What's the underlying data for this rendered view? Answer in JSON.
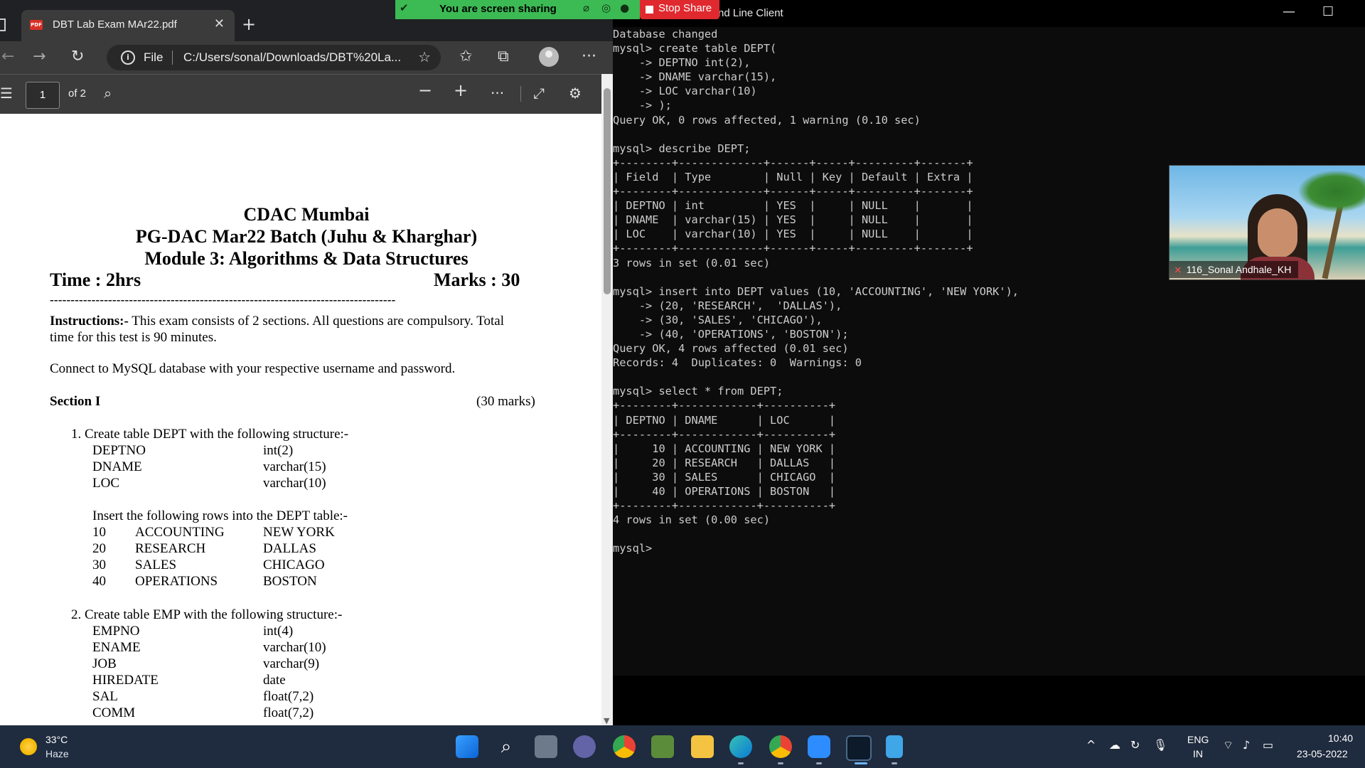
{
  "browser": {
    "tab_title": "DBT Lab Exam MAr22.pdf",
    "file_label": "File",
    "url": "C:/Users/sonal/Downloads/DBT%20La...",
    "page_number": "1",
    "page_total": "of 2"
  },
  "pdf": {
    "title1": "CDAC Mumbai",
    "title2": "PG-DAC Mar22 Batch (Juhu & Kharghar)",
    "title3": "Module 3: Algorithms & Data Structures",
    "time": "Time : 2hrs",
    "marks": "Marks : 30",
    "dashes": "-----------------------------------------------------------------------------------",
    "instructions_label": "Instructions:-",
    "instructions_text": " This exam consists of 2 sections.  All questions are compulsory. Total",
    "instructions_text2": "time for this test is 90 minutes.",
    "connect": "Connect to MySQL database with your respective username and password.",
    "section": "Section I",
    "section_marks": "(30 marks)",
    "q1": "1.   Create table DEPT with the following structure:-",
    "q1_fields": [
      {
        "name": "DEPTNO",
        "type": "int(2)"
      },
      {
        "name": "DNAME",
        "type": "varchar(15)"
      },
      {
        "name": "LOC",
        "type": "varchar(10)"
      }
    ],
    "q1_insert": "Insert the following rows into the DEPT table:-",
    "q1_rows": [
      {
        "no": "10",
        "name": "ACCOUNTING",
        "loc": "NEW YORK"
      },
      {
        "no": "20",
        "name": "RESEARCH",
        "loc": "DALLAS"
      },
      {
        "no": "30",
        "name": "SALES",
        "loc": "CHICAGO"
      },
      {
        "no": "40",
        "name": "OPERATIONS",
        "loc": "BOSTON"
      }
    ],
    "q2": "2.   Create table EMP with the following structure:-",
    "q2_fields": [
      {
        "name": "EMPNO",
        "type": "int(4)"
      },
      {
        "name": "ENAME",
        "type": "varchar(10)"
      },
      {
        "name": "JOB",
        "type": "varchar(9)"
      },
      {
        "name": "HIREDATE",
        "type": "date"
      },
      {
        "name": "SAL",
        "type": "float(7,2)"
      },
      {
        "name": "COMM",
        "type": "float(7,2)"
      }
    ]
  },
  "share": {
    "message": "You are screen sharing",
    "stop_label": "Stop Share"
  },
  "terminal": {
    "title": "nd Line Client",
    "output": "Database changed\nmysql> create table DEPT(\n    -> DEPTNO int(2),\n    -> DNAME varchar(15),\n    -> LOC varchar(10)\n    -> );\nQuery OK, 0 rows affected, 1 warning (0.10 sec)\n\nmysql> describe DEPT;\n+--------+-------------+------+-----+---------+-------+\n| Field  | Type        | Null | Key | Default | Extra |\n+--------+-------------+------+-----+---------+-------+\n| DEPTNO | int         | YES  |     | NULL    |       |\n| DNAME  | varchar(15) | YES  |     | NULL    |       |\n| LOC    | varchar(10) | YES  |     | NULL    |       |\n+--------+-------------+------+-----+---------+-------+\n3 rows in set (0.01 sec)\n\nmysql> insert into DEPT values (10, 'ACCOUNTING', 'NEW YORK'),\n    -> (20, 'RESEARCH',  'DALLAS'),\n    -> (30, 'SALES', 'CHICAGO'),\n    -> (40, 'OPERATIONS', 'BOSTON');\nQuery OK, 4 rows affected (0.01 sec)\nRecords: 4  Duplicates: 0  Warnings: 0\n\nmysql> select * from DEPT;\n+--------+------------+----------+\n| DEPTNO | DNAME      | LOC      |\n+--------+------------+----------+\n|     10 | ACCOUNTING | NEW YORK |\n|     20 | RESEARCH   | DALLAS   |\n|     30 | SALES      | CHICAGO  |\n|     40 | OPERATIONS | BOSTON   |\n+--------+------------+----------+\n4 rows in set (0.00 sec)\n\nmysql>"
  },
  "video": {
    "participant": "116_Sonal Andhale_KH"
  },
  "taskbar": {
    "temperature": "33°C",
    "weather": "Haze",
    "lang_line1": "ENG",
    "lang_line2": "IN",
    "time": "10:40",
    "date": "23-05-2022"
  }
}
